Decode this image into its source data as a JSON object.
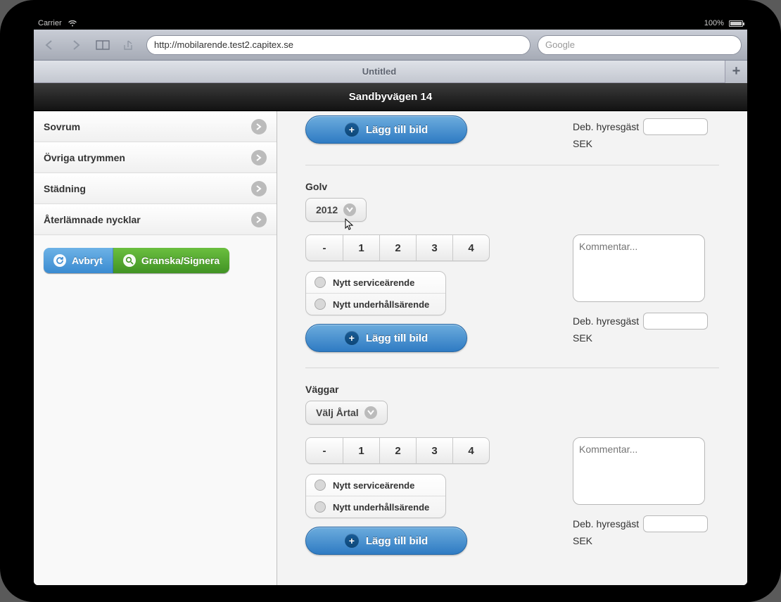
{
  "statusbar": {
    "carrier": "Carrier",
    "battery": "100%"
  },
  "browser": {
    "url": "http://mobilarende.test2.capitex.se",
    "search_placeholder": "Google",
    "tab_title": "Untitled"
  },
  "app": {
    "title": "Sandbyvägen 14",
    "sidebar": {
      "items": [
        {
          "label": "Sovrum"
        },
        {
          "label": "Övriga utrymmen"
        },
        {
          "label": "Städning"
        },
        {
          "label": "Återlämnade nycklar"
        }
      ],
      "cancel": "Avbryt",
      "review": "Granska/Signera"
    },
    "common": {
      "add_image": "Lägg till bild",
      "new_service": "Nytt serviceärende",
      "new_maintenance": "Nytt underhållsärende",
      "segments": [
        "-",
        "1",
        "2",
        "3",
        "4"
      ],
      "comment_placeholder": "Kommentar...",
      "deb_label": "Deb. hyresgäst",
      "sek": "SEK",
      "select_year": "Välj Årtal"
    },
    "sections": [
      {
        "title": "",
        "year": ""
      },
      {
        "title": "Golv",
        "year": "2012"
      },
      {
        "title": "Väggar",
        "year": "Välj Årtal"
      }
    ]
  }
}
